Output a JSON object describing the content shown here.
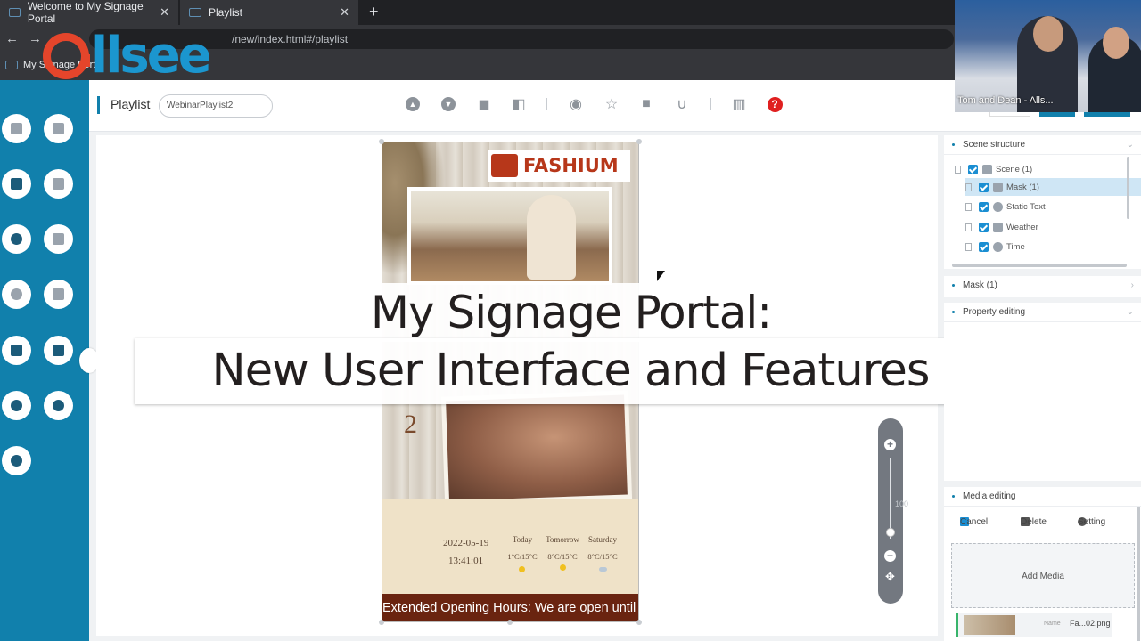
{
  "browser": {
    "tabs": [
      {
        "title": "Welcome to My Signage Portal"
      },
      {
        "title": "Playlist"
      }
    ],
    "new_tab": "+",
    "url": "/new/index.html#/playlist",
    "bookmark": "My Signage Portal"
  },
  "logo": {
    "brand": "llsee"
  },
  "toolbar": {
    "title": "Playlist",
    "playlist_name": "WebinarPlaylist2"
  },
  "scene": {
    "brand_name": "FASHIUM",
    "number": "2",
    "date": "2022-05-19",
    "time": "13:41:01",
    "weather": [
      {
        "day": "Today",
        "temp": "1°C/15°C",
        "icon": "sun-icon"
      },
      {
        "day": "Tomorrow",
        "temp": "8°C/15°C",
        "icon": "sun-icon"
      },
      {
        "day": "Saturday",
        "temp": "8°C/15°C",
        "icon": "cloud-icon"
      }
    ],
    "ticker": "Extended Opening Hours: We are open until"
  },
  "overlay": {
    "line1": "My Signage Portal:",
    "line2": "New User Interface and Features"
  },
  "zoom": {
    "value": "100"
  },
  "panels": {
    "scene_structure": {
      "title": "Scene structure",
      "items": [
        {
          "label": "Scene (1)"
        },
        {
          "label": "Mask (1)"
        },
        {
          "label": "Static Text"
        },
        {
          "label": "Weather"
        },
        {
          "label": "Time"
        }
      ]
    },
    "mask": {
      "title": "Mask (1)"
    },
    "property": {
      "title": "Property editing"
    },
    "media": {
      "title": "Media editing",
      "cancel": "Cancel",
      "delete": "Delete",
      "setting": "Setting",
      "add_media": "Add Media",
      "item_label": "Name",
      "item_name": "Fa...02.png"
    }
  },
  "video": {
    "label": "Tom and Dean - Alls..."
  },
  "colors": {
    "accent": "#1180ac",
    "logo_orange": "#e5452b",
    "logo_blue": "#1b96cf",
    "help_red": "#e02020"
  }
}
